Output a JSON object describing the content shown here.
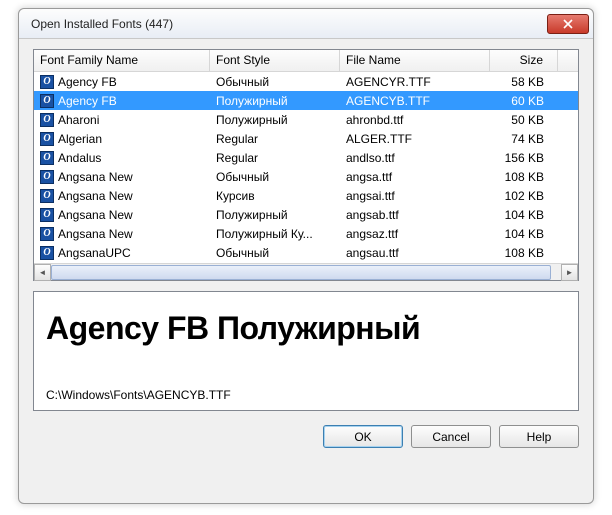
{
  "window": {
    "title": "Open Installed Fonts (447)"
  },
  "columns": {
    "name": "Font Family Name",
    "style": "Font Style",
    "file": "File Name",
    "size": "Size"
  },
  "rows": [
    {
      "name": "Agency FB",
      "style": "Обычный",
      "file": "AGENCYR.TTF",
      "size": "58 KB",
      "selected": false
    },
    {
      "name": "Agency FB",
      "style": "Полужирный",
      "file": "AGENCYB.TTF",
      "size": "60 KB",
      "selected": true
    },
    {
      "name": "Aharoni",
      "style": "Полужирный",
      "file": "ahronbd.ttf",
      "size": "50 KB",
      "selected": false
    },
    {
      "name": "Algerian",
      "style": "Regular",
      "file": "ALGER.TTF",
      "size": "74 KB",
      "selected": false
    },
    {
      "name": "Andalus",
      "style": "Regular",
      "file": "andlso.ttf",
      "size": "156 KB",
      "selected": false
    },
    {
      "name": "Angsana New",
      "style": "Обычный",
      "file": "angsa.ttf",
      "size": "108 KB",
      "selected": false
    },
    {
      "name": "Angsana New",
      "style": "Курсив",
      "file": "angsai.ttf",
      "size": "102 KB",
      "selected": false
    },
    {
      "name": "Angsana New",
      "style": "Полужирный",
      "file": "angsab.ttf",
      "size": "104 KB",
      "selected": false
    },
    {
      "name": "Angsana New",
      "style": "Полужирный Ку...",
      "file": "angsaz.ttf",
      "size": "104 KB",
      "selected": false
    },
    {
      "name": "AngsanaUPC",
      "style": "Обычный",
      "file": "angsau.ttf",
      "size": "108 KB",
      "selected": false
    }
  ],
  "preview": {
    "text": "Agency FB Полужирный",
    "path": "C:\\Windows\\Fonts\\AGENCYB.TTF"
  },
  "buttons": {
    "ok": "OK",
    "cancel": "Cancel",
    "help": "Help"
  }
}
